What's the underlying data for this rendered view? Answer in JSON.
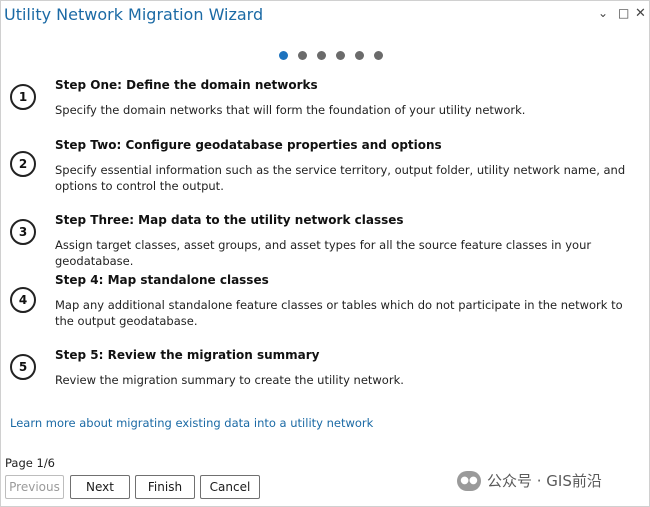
{
  "window": {
    "title": "Utility Network Migration Wizard"
  },
  "window_controls": {
    "chevron": "⌄",
    "maximize": "□",
    "close": "✕"
  },
  "pager": {
    "total": 6,
    "current": 1
  },
  "steps": [
    {
      "number": "1",
      "title": "Step One: Define the domain networks",
      "description": "Specify the domain networks that will form the foundation of your utility network."
    },
    {
      "number": "2",
      "title": "Step Two: Configure geodatabase properties and options",
      "description": "Specify essential information such as the service territory, output folder, utility network name, and options to control the output."
    },
    {
      "number": "3",
      "title": "Step Three: Map data to the utility network classes",
      "description": "Assign target classes, asset groups, and asset types for all the source feature classes in your geodatabase."
    },
    {
      "number": "4",
      "title": "Step 4: Map standalone classes",
      "description": "Map any additional standalone feature classes or tables which do not participate in the network to the output geodatabase."
    },
    {
      "number": "5",
      "title": "Step 5: Review the migration summary",
      "description": "Review the migration summary to create the utility network."
    }
  ],
  "learn_more": {
    "label": "Learn more about migrating existing data into a utility network"
  },
  "footer": {
    "page_label": "Page 1/6",
    "buttons": {
      "previous": "Previous",
      "next": "Next",
      "finish": "Finish",
      "cancel": "Cancel"
    }
  },
  "watermark": {
    "text": "公众号 · GIS前沿"
  },
  "colors": {
    "accent": "#1e73be",
    "title": "#1b6aa5",
    "dot_inactive": "#6b6b6b"
  }
}
